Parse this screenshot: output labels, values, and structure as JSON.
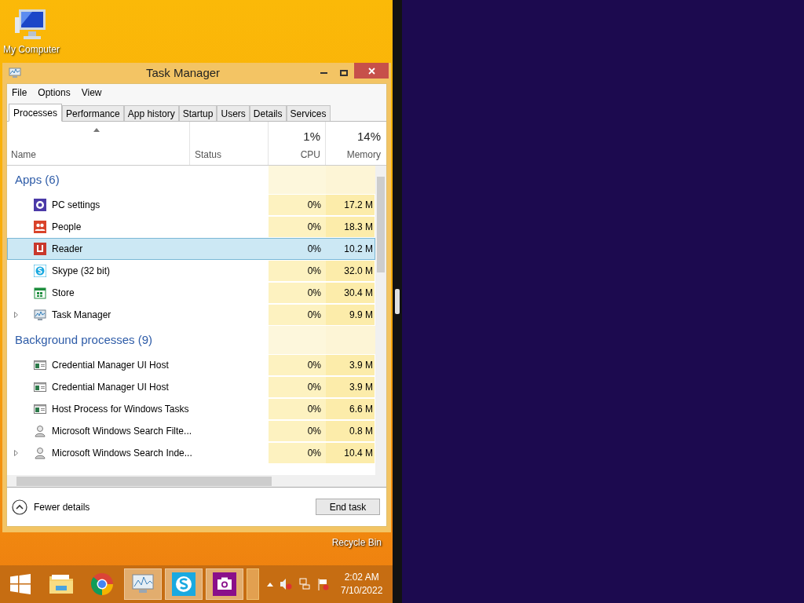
{
  "desktop_icons": [
    {
      "kind": "computer",
      "label": "My Computer"
    },
    {
      "kind": "bin",
      "label": "Recycle Bin"
    }
  ],
  "window": {
    "title": "Task Manager"
  },
  "menu": [
    "File",
    "Options",
    "View"
  ],
  "tabs": [
    {
      "label": "Processes",
      "selected": true
    },
    {
      "label": "Performance",
      "selected": false
    },
    {
      "label": "App history",
      "selected": false
    },
    {
      "label": "Startup",
      "selected": false
    },
    {
      "label": "Users",
      "selected": false
    },
    {
      "label": "Details",
      "selected": false
    },
    {
      "label": "Services",
      "selected": false
    }
  ],
  "columns": {
    "name": "Name",
    "status": "Status",
    "cpu": {
      "total": "1%",
      "label": "CPU"
    },
    "memory": {
      "total": "14%",
      "label": "Memory"
    }
  },
  "groups": [
    {
      "title": "Apps (6)",
      "rows": [
        {
          "kind": "settings",
          "name": "PC settings",
          "cpu": "0%",
          "memory": "17.2 M",
          "selected": false,
          "expandable": false
        },
        {
          "kind": "people",
          "name": "People",
          "cpu": "0%",
          "memory": "18.3 M",
          "selected": false,
          "expandable": false
        },
        {
          "kind": "reader",
          "name": "Reader",
          "cpu": "0%",
          "memory": "10.2 M",
          "selected": true,
          "expandable": false
        },
        {
          "kind": "skype",
          "name": "Skype (32 bit)",
          "cpu": "0%",
          "memory": "32.0 M",
          "selected": false,
          "expandable": false
        },
        {
          "kind": "store",
          "name": "Store",
          "cpu": "0%",
          "memory": "30.4 M",
          "selected": false,
          "expandable": false
        },
        {
          "kind": "monitor",
          "name": "Task Manager",
          "cpu": "0%",
          "memory": "9.9 M",
          "selected": false,
          "expandable": true
        }
      ]
    },
    {
      "title": "Background processes (9)",
      "rows": [
        {
          "kind": "window",
          "name": "Credential Manager UI Host",
          "cpu": "0%",
          "memory": "3.9 M",
          "selected": false,
          "expandable": false
        },
        {
          "kind": "window",
          "name": "Credential Manager UI Host",
          "cpu": "0%",
          "memory": "3.9 M",
          "selected": false,
          "expandable": false
        },
        {
          "kind": "window",
          "name": "Host Process for Windows Tasks",
          "cpu": "0%",
          "memory": "6.6 M",
          "selected": false,
          "expandable": false
        },
        {
          "kind": "user",
          "name": "Microsoft Windows Search Filte...",
          "cpu": "0%",
          "memory": "0.8 M",
          "selected": false,
          "expandable": false
        },
        {
          "kind": "user",
          "name": "Microsoft Windows Search Inde...",
          "cpu": "0%",
          "memory": "10.4 M",
          "selected": false,
          "expandable": true
        }
      ]
    }
  ],
  "footer": {
    "toggle": "Fewer details",
    "button": "End task"
  },
  "taskbar": {
    "items": [
      {
        "kind": "start",
        "active": false
      },
      {
        "kind": "explorer",
        "active": false
      },
      {
        "kind": "chrome",
        "active": false
      },
      {
        "kind": "monitor",
        "active": true
      },
      {
        "kind": "skype",
        "active": true
      },
      {
        "kind": "camera",
        "active": true
      }
    ],
    "time": "2:02 AM",
    "date": "7/10/2022"
  }
}
